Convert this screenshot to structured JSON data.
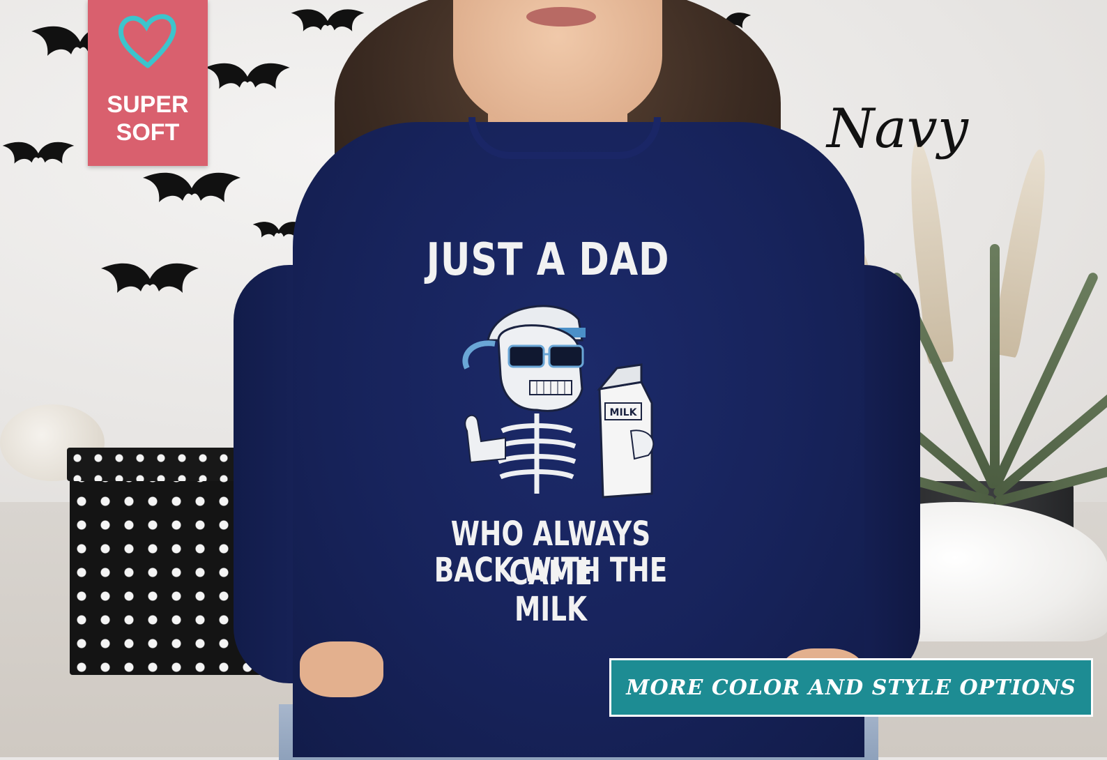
{
  "product": {
    "print": {
      "title": "JUST A DAD",
      "line1": "WHO ALWAYS CAME",
      "line2": "BACK WITH THE MILK",
      "carton_label": "MILK"
    },
    "color_name": "Navy",
    "sweater_color": "#17235b"
  },
  "badge": {
    "line1": "SUPER",
    "line2": "SOFT",
    "icon": "heart-icon",
    "color": "#d9606e"
  },
  "options_banner": {
    "label": "MORE COLOR AND STYLE OPTIONS",
    "color": "#1d8c93"
  }
}
